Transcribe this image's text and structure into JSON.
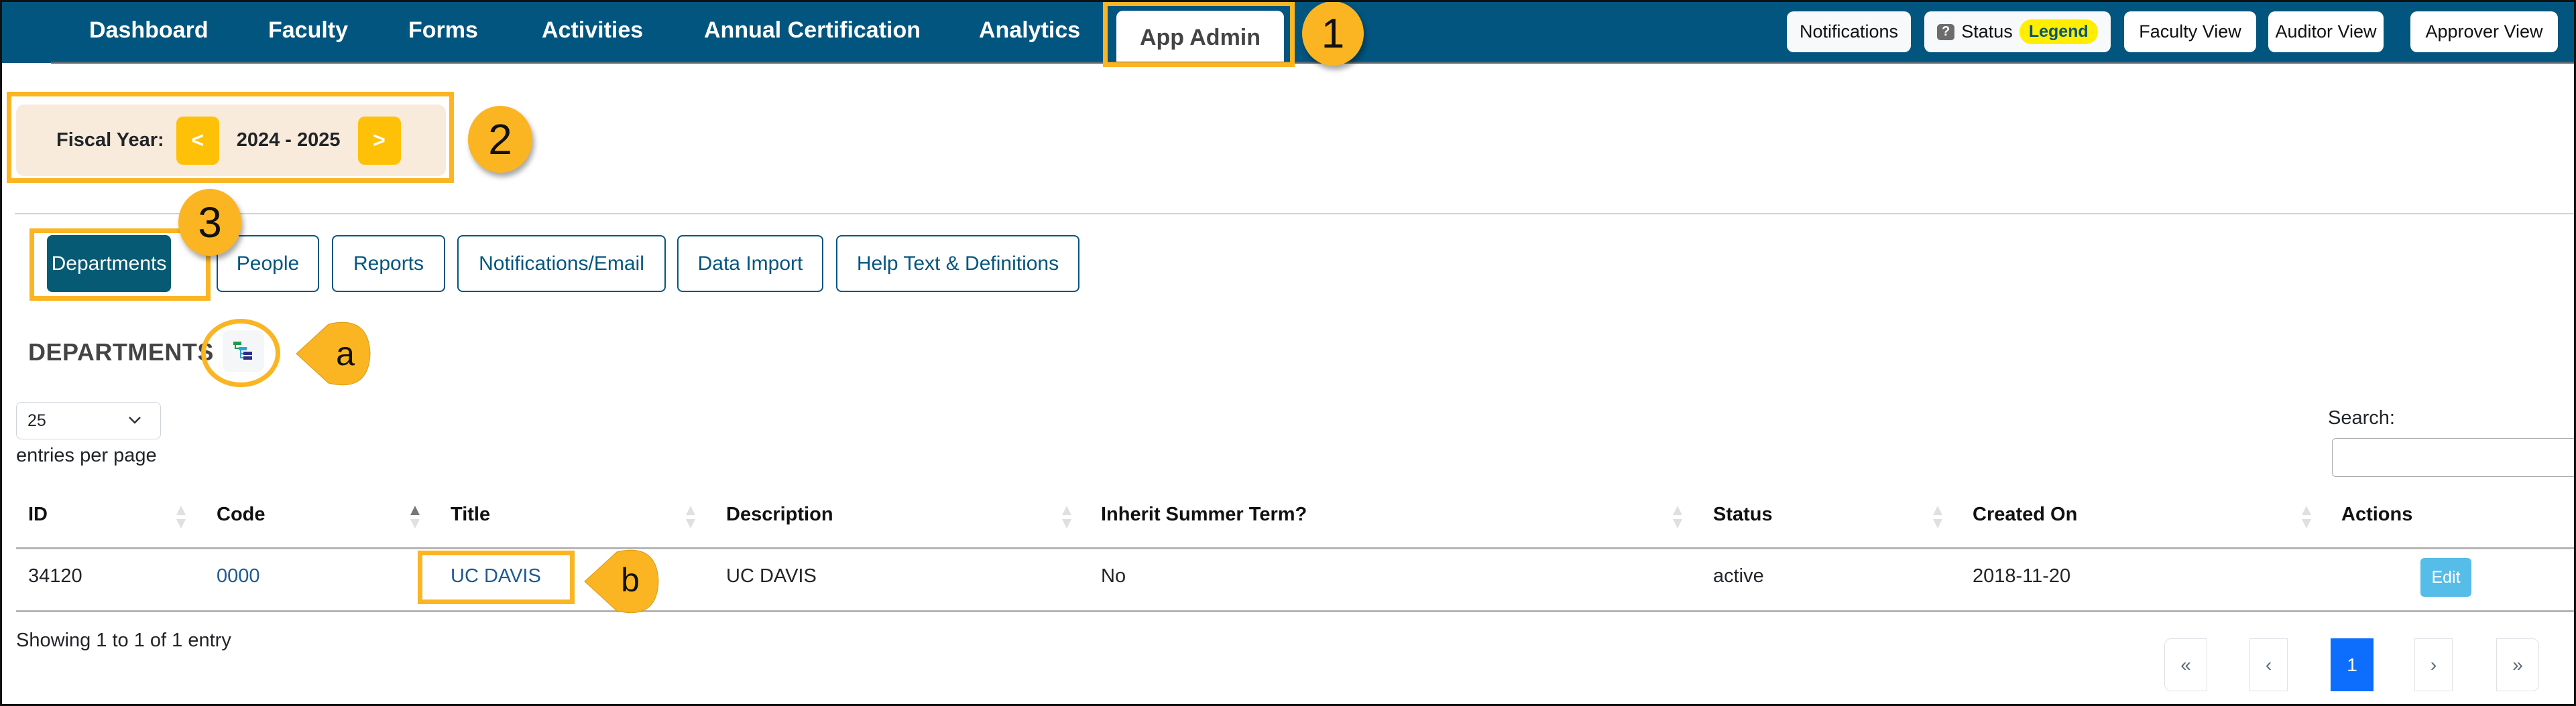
{
  "nav": {
    "items": [
      "Dashboard",
      "Faculty",
      "Forms",
      "Activities",
      "Annual Certification",
      "Analytics"
    ],
    "active_tab": "App Admin",
    "buttons": {
      "notifications": "Notifications",
      "status": "Status",
      "status_icon": "?",
      "legend": "Legend",
      "faculty_view": "Faculty View",
      "auditor_view": "Auditor View",
      "approver_view": "Approver View"
    }
  },
  "fiscal_year": {
    "label": "Fiscal Year:",
    "prev": "<",
    "value": "2024 - 2025",
    "next": ">"
  },
  "tabs": [
    "Departments",
    "People",
    "Reports",
    "Notifications/Email",
    "Data Import",
    "Help Text & Definitions"
  ],
  "active_tab_index": 0,
  "section": {
    "heading": "DEPARTMENTS",
    "hierarchy_icon": "hierarchy-tree-icon"
  },
  "table_controls": {
    "page_size": "25",
    "entries_label": "entries per page",
    "search_label": "Search:",
    "search_value": ""
  },
  "table": {
    "columns": [
      "ID",
      "Code",
      "Title",
      "Description",
      "Inherit Summer Term?",
      "Status",
      "Created On",
      "Actions"
    ],
    "sorted_column": "Code",
    "sort_direction": "ascending",
    "rows": [
      {
        "id": "34120",
        "code": "0000",
        "title": "UC DAVIS",
        "description": "UC DAVIS",
        "inherit_summer_term": "No",
        "status": "active",
        "created_on": "2018-11-20",
        "action": "Edit"
      }
    ]
  },
  "footer": {
    "showing": "Showing 1 to 1 of 1 entry",
    "pagination": {
      "first": "«",
      "prev": "‹",
      "current": "1",
      "next": "›",
      "last": "»"
    }
  },
  "annotations": {
    "badge_1": "1",
    "badge_2": "2",
    "badge_3": "3",
    "badge_a": "a",
    "badge_b": "b"
  },
  "colors": {
    "nav_bg": "#02557f",
    "highlight": "#fbb522",
    "active_tab": "#065a73",
    "fy_button": "#ffc107",
    "fiscal_bg": "#f8ebdc",
    "legend_pill": "#ffee00",
    "edit_button": "#56bce8",
    "page_active": "#0d6efd",
    "link": "#1c5a96"
  }
}
